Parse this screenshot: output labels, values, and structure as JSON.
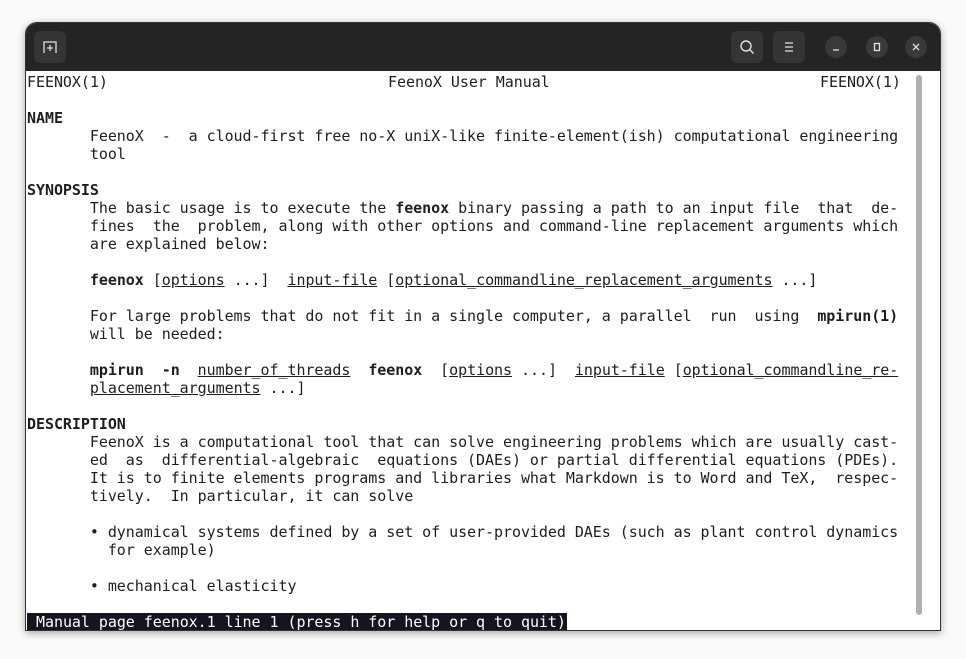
{
  "window": {
    "new_tab_icon": "new-tab-icon",
    "search_icon": "search-icon",
    "menu_icon": "hamburger-menu-icon",
    "minimize_icon": "minimize-icon",
    "maximize_icon": "maximize-icon",
    "close_icon": "close-icon"
  },
  "terminal": {
    "header": {
      "left": "FEENOX(1)",
      "center": "FeenoX User Manual",
      "right": "FEENOX(1)"
    },
    "lines": [
      [],
      [
        [
          "NAME",
          "b"
        ]
      ],
      [
        [
          "       FeenoX  -  a cloud-first free no-X uniX-like finite-element(ish) computational engineering",
          ""
        ]
      ],
      [
        [
          "       tool",
          ""
        ]
      ],
      [],
      [
        [
          "SYNOPSIS",
          "b"
        ]
      ],
      [
        [
          "       The basic usage is to execute the ",
          ""
        ],
        [
          "feenox",
          "b"
        ],
        [
          " binary passing a path to an input file  that  de-",
          ""
        ]
      ],
      [
        [
          "       fines  the  problem, along with other options and command-line replacement arguments which",
          ""
        ]
      ],
      [
        [
          "       are explained below:",
          ""
        ]
      ],
      [],
      [
        [
          "       ",
          ""
        ],
        [
          "feenox",
          "b"
        ],
        [
          " [",
          ""
        ],
        [
          "options",
          "u"
        ],
        [
          " ...]  ",
          ""
        ],
        [
          "input-file",
          "u"
        ],
        [
          " [",
          ""
        ],
        [
          "optional_commandline_replacement_arguments",
          "u"
        ],
        [
          " ...]",
          ""
        ]
      ],
      [],
      [
        [
          "       For large problems that do not fit in a single computer, a parallel  run  using  ",
          ""
        ],
        [
          "mpirun(1)",
          "b"
        ]
      ],
      [
        [
          "       will be needed:",
          ""
        ]
      ],
      [],
      [
        [
          "       ",
          ""
        ],
        [
          "mpirun  -n",
          "b"
        ],
        [
          "  ",
          ""
        ],
        [
          "number_of_threads",
          "u"
        ],
        [
          "  ",
          ""
        ],
        [
          "feenox",
          "b"
        ],
        [
          "  [",
          ""
        ],
        [
          "options",
          "u"
        ],
        [
          " ...]  ",
          ""
        ],
        [
          "input-file",
          "u"
        ],
        [
          " [",
          ""
        ],
        [
          "optional_commandline_re-",
          "u"
        ]
      ],
      [
        [
          "       ",
          ""
        ],
        [
          "placement_arguments",
          "u"
        ],
        [
          " ...]",
          ""
        ]
      ],
      [],
      [
        [
          "DESCRIPTION",
          "b"
        ]
      ],
      [
        [
          "       FeenoX is a computational tool that can solve engineering problems which are usually cast-",
          ""
        ]
      ],
      [
        [
          "       ed  as  differential-algebraic  equations (DAEs) or partial differential equations (PDEs).",
          ""
        ]
      ],
      [
        [
          "       It is to finite elements programs and libraries what Markdown is to Word and TeX,  respec-",
          ""
        ]
      ],
      [
        [
          "       tively.  In particular, it can solve",
          ""
        ]
      ],
      [],
      [
        [
          "       • dynamical systems defined by a set of user-provided DAEs (such as plant control dynamics",
          ""
        ]
      ],
      [
        [
          "         for example)",
          ""
        ]
      ],
      [],
      [
        [
          "       • mechanical elasticity",
          ""
        ]
      ],
      []
    ],
    "status": "Manual page feenox.1 line 1 (press h for help or q to quit)"
  }
}
